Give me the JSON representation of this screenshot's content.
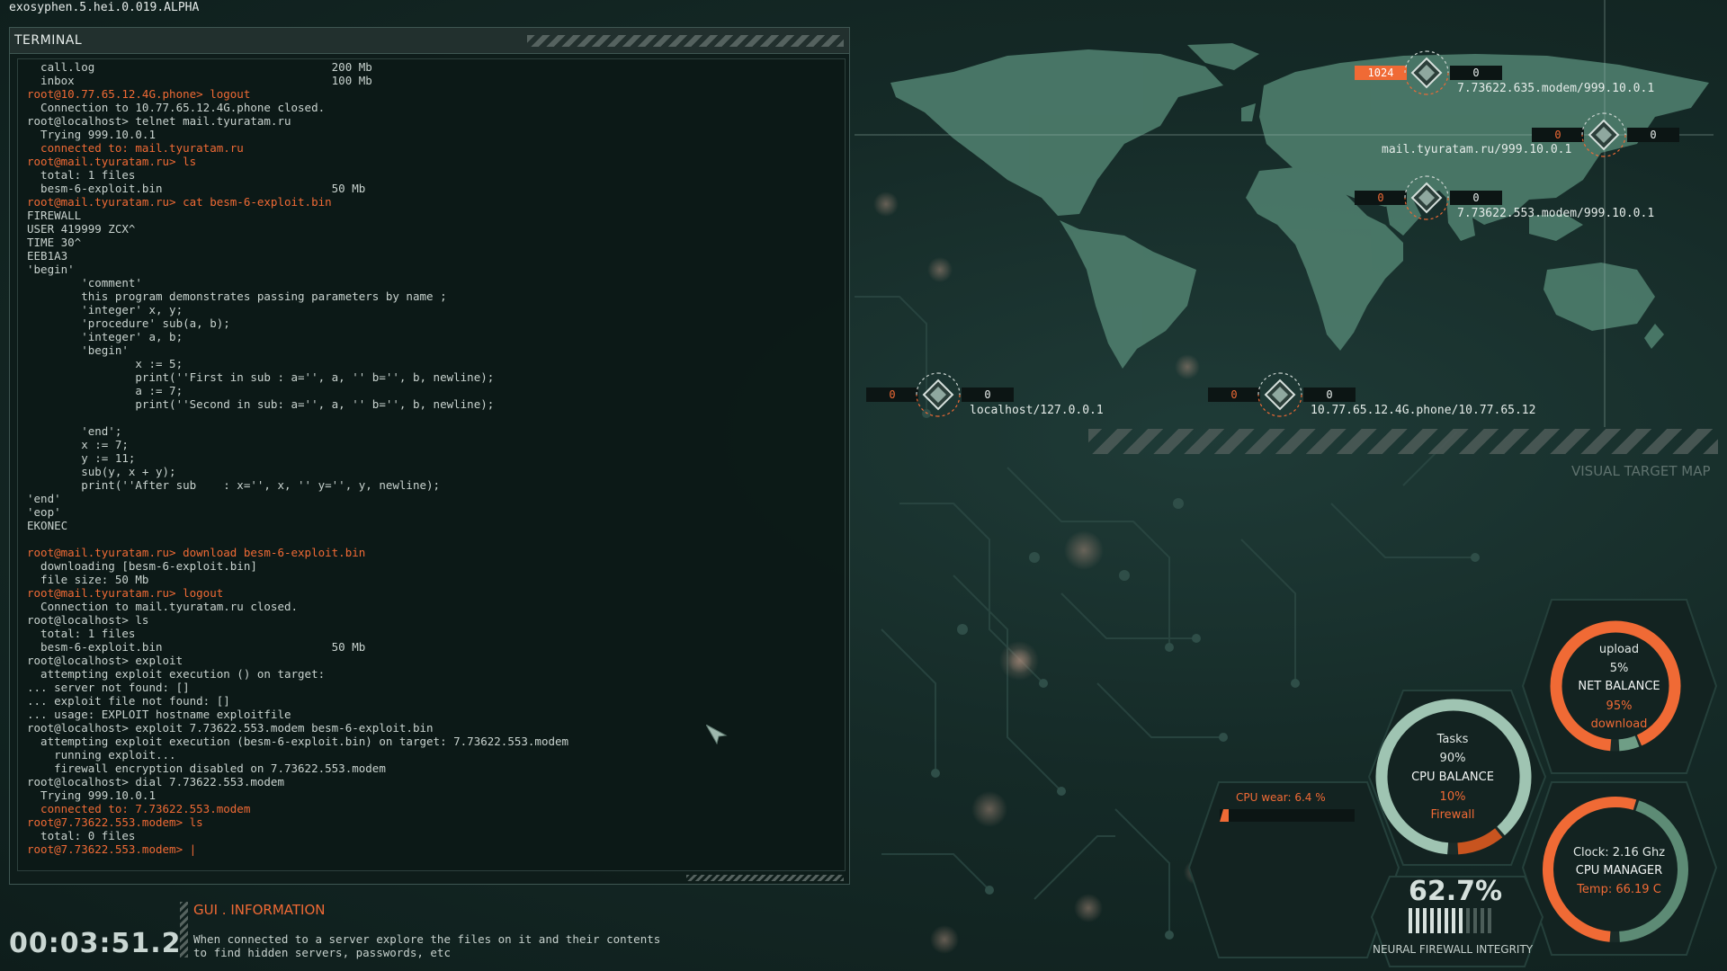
{
  "version": "exosyphen.5.hei.0.019.ALPHA",
  "terminal": {
    "title": "TERMINAL",
    "lines": [
      {
        "t": "  call.log                                   200 Mb",
        "c": "n"
      },
      {
        "t": "  inbox                                      100 Mb",
        "c": "n"
      },
      {
        "t": "root@10.77.65.12.4G.phone> logout",
        "c": "o"
      },
      {
        "t": "  Connection to 10.77.65.12.4G.phone closed.",
        "c": "n"
      },
      {
        "t": "root@localhost> telnet mail.tyuratam.ru",
        "c": "n"
      },
      {
        "t": "  Trying 999.10.0.1",
        "c": "n"
      },
      {
        "t": "  connected to: mail.tyuratam.ru",
        "c": "o"
      },
      {
        "t": "root@mail.tyuratam.ru> ls",
        "c": "o"
      },
      {
        "t": "  total: 1 files",
        "c": "n"
      },
      {
        "t": "  besm-6-exploit.bin                         50 Mb",
        "c": "n"
      },
      {
        "t": "root@mail.tyuratam.ru> cat besm-6-exploit.bin",
        "c": "o"
      },
      {
        "t": "FIREWALL",
        "c": "n"
      },
      {
        "t": "USER 419999 ZCX^",
        "c": "n"
      },
      {
        "t": "TIME 30^",
        "c": "n"
      },
      {
        "t": "EEB1A3",
        "c": "n"
      },
      {
        "t": "'begin'",
        "c": "n"
      },
      {
        "t": "        'comment'",
        "c": "n"
      },
      {
        "t": "        this program demonstrates passing parameters by name ;",
        "c": "n"
      },
      {
        "t": "        'integer' x, y;",
        "c": "n"
      },
      {
        "t": "        'procedure' sub(a, b);",
        "c": "n"
      },
      {
        "t": "        'integer' a, b;",
        "c": "n"
      },
      {
        "t": "        'begin'",
        "c": "n"
      },
      {
        "t": "                x := 5;",
        "c": "n"
      },
      {
        "t": "                print(''First in sub : a='', a, '' b='', b, newline);",
        "c": "n"
      },
      {
        "t": "                a := 7;",
        "c": "n"
      },
      {
        "t": "                print(''Second in sub: a='', a, '' b='', b, newline);",
        "c": "n"
      },
      {
        "t": "",
        "c": "n"
      },
      {
        "t": "        'end';",
        "c": "n"
      },
      {
        "t": "        x := 7;",
        "c": "n"
      },
      {
        "t": "        y := 11;",
        "c": "n"
      },
      {
        "t": "        sub(y, x + y);",
        "c": "n"
      },
      {
        "t": "        print(''After sub    : x='', x, '' y='', y, newline);",
        "c": "n"
      },
      {
        "t": "'end'",
        "c": "n"
      },
      {
        "t": "'eop'",
        "c": "n"
      },
      {
        "t": "EKONEC",
        "c": "n"
      },
      {
        "t": "",
        "c": "n"
      },
      {
        "t": "root@mail.tyuratam.ru> download besm-6-exploit.bin",
        "c": "o"
      },
      {
        "t": "  downloading [besm-6-exploit.bin]",
        "c": "n"
      },
      {
        "t": "  file size: 50 Mb",
        "c": "n"
      },
      {
        "t": "root@mail.tyuratam.ru> logout",
        "c": "o"
      },
      {
        "t": "  Connection to mail.tyuratam.ru closed.",
        "c": "n"
      },
      {
        "t": "root@localhost> ls",
        "c": "n"
      },
      {
        "t": "  total: 1 files",
        "c": "n"
      },
      {
        "t": "  besm-6-exploit.bin                         50 Mb",
        "c": "n"
      },
      {
        "t": "root@localhost> exploit",
        "c": "n"
      },
      {
        "t": "  attempting exploit execution () on target:",
        "c": "n"
      },
      {
        "t": "... server not found: []",
        "c": "n"
      },
      {
        "t": "... exploit file not found: []",
        "c": "n"
      },
      {
        "t": "... usage: EXPLOIT hostname exploitfile",
        "c": "n"
      },
      {
        "t": "root@localhost> exploit 7.73622.553.modem besm-6-exploit.bin",
        "c": "n"
      },
      {
        "t": "  attempting exploit execution (besm-6-exploit.bin) on target: 7.73622.553.modem",
        "c": "n"
      },
      {
        "t": "    running exploit...",
        "c": "n"
      },
      {
        "t": "    firewall encryption disabled on 7.73622.553.modem",
        "c": "n"
      },
      {
        "t": "root@localhost> dial 7.73622.553.modem",
        "c": "n"
      },
      {
        "t": "  Trying 999.10.0.1",
        "c": "n"
      },
      {
        "t": "  connected to: 7.73622.553.modem",
        "c": "o"
      },
      {
        "t": "root@7.73622.553.modem> ls",
        "c": "o"
      },
      {
        "t": "  total: 0 files",
        "c": "n"
      },
      {
        "t": "root@7.73622.553.modem> |",
        "c": "o"
      }
    ]
  },
  "clock": "00:03:51.2",
  "info": {
    "title": "GUI . INFORMATION",
    "line1": "When connected to a server explore the files on it and their contents",
    "line2": "to find hidden servers, passwords, etc"
  },
  "map": {
    "caption": "VISUAL TARGET MAP",
    "nodes": [
      {
        "left": "1024",
        "right": "0",
        "label": "7.73622.635.modem/999.10.0.1",
        "hot": true
      },
      {
        "left": "0",
        "right": "0",
        "label": "mail.tyuratam.ru/999.10.0.1",
        "hot": false
      },
      {
        "left": "0",
        "right": "0",
        "label": "7.73622.553.modem/999.10.0.1",
        "hot": false
      },
      {
        "left": "0",
        "right": "0",
        "label": "localhost/127.0.0.1",
        "hot": false
      },
      {
        "left": "0",
        "right": "0",
        "label": "10.77.65.12.4G.phone/10.77.65.12",
        "hot": false
      }
    ]
  },
  "widgets": {
    "net_balance": {
      "upload_label": "upload",
      "upload_pct": "5%",
      "title": "NET BALANCE",
      "download_pct": "95%",
      "download_label": "download",
      "download_fraction": 0.95
    },
    "cpu_balance": {
      "tasks_label": "Tasks",
      "tasks_pct": "90%",
      "title": "CPU BALANCE",
      "firewall_pct": "10%",
      "firewall_label": "Firewall",
      "tasks_fraction": 0.9
    },
    "cpu_manager": {
      "clock": "Clock: 2.16 Ghz",
      "title": "CPU MANAGER",
      "temp": "Temp: 66.19 C",
      "load_fraction": 0.55
    },
    "cpu_wear": {
      "label": "CPU wear: 6.4 %",
      "fraction": 0.064
    },
    "firewall": {
      "value": "62.7%",
      "label": "NEURAL FIREWALL INTEGRITY",
      "fraction": 0.627
    }
  },
  "colors": {
    "accent": "#f06a35",
    "map_land": "#4b7a6a",
    "text": "#d8e2de",
    "ring_green": "#6f9e86"
  }
}
